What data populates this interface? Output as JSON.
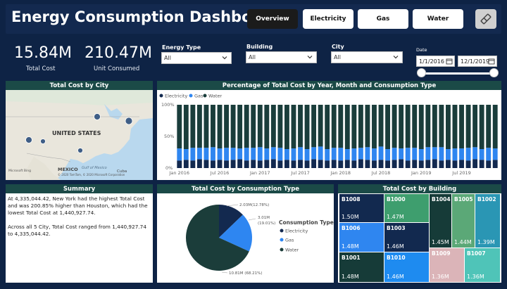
{
  "header": {
    "title": "Energy Consumption Dashboard",
    "tabs": [
      {
        "label": "Overview",
        "active": true
      },
      {
        "label": "Electricity",
        "active": false
      },
      {
        "label": "Gas",
        "active": false
      },
      {
        "label": "Water",
        "active": false
      }
    ],
    "clear_filters_icon": "eraser-icon"
  },
  "kpis": {
    "total_cost": {
      "value": "15.84M",
      "label": "Total Cost"
    },
    "unit_consumed": {
      "value": "210.47M",
      "label": "Unit Consumed"
    }
  },
  "slicers": {
    "energy_type": {
      "label": "Energy Type",
      "value": "All"
    },
    "building": {
      "label": "Building",
      "value": "All"
    },
    "city": {
      "label": "City",
      "value": "All"
    },
    "date": {
      "label": "Date",
      "start": "1/1/2016",
      "end": "12/1/2019"
    }
  },
  "map": {
    "title": "Total Cost by City",
    "labels": {
      "country": "UNITED STATES",
      "mexico": "MEXICO",
      "gulf": "Gulf of Mexico",
      "cuba": "Cuba"
    },
    "attribution": "© 2020 TomTom, © 2020 Microsoft Corporation",
    "brand": "Microsoft Bing"
  },
  "summary": {
    "title": "Summary",
    "paragraph1": "At 4,335,044.42, New York had the highest Total Cost and was 200.85% higher than Houston, which had the lowest Total Cost at 1,440,927.74.",
    "paragraph2": "Across all 5 City, Total Cost ranged from 1,440,927.74 to 4,335,044.42."
  },
  "chart_data": [
    {
      "type": "bar",
      "stacked": "100%",
      "title": "Percentage of Total Cost by Year, Month and Consumption Type",
      "legend_position": "top-left",
      "series_names": [
        "Electricity",
        "Gas",
        "Water"
      ],
      "colors": {
        "Electricity": "#12294f",
        "Gas": "#2f86f0",
        "Water": "#1a3d3b"
      },
      "y_ticks": [
        "100%",
        "50%",
        "0%"
      ],
      "ylim": [
        0,
        100
      ],
      "x_ticks": [
        "Jan 2016",
        "Jul 2016",
        "Jan 2017",
        "Jul 2017",
        "Jan 2018",
        "Jul 2018",
        "Jan 2019",
        "Jul 2019"
      ],
      "start_month": "2016-01",
      "months": 48,
      "electricity_pct": [
        12,
        13,
        12,
        14,
        13,
        12,
        13,
        12,
        13,
        14,
        12,
        13,
        12,
        13,
        14,
        12,
        13,
        12,
        13,
        12,
        14,
        13,
        12,
        13,
        12,
        13,
        12,
        14,
        13,
        12,
        13,
        12,
        13,
        14,
        12,
        13,
        12,
        13,
        14,
        12,
        13,
        12,
        13,
        12,
        14,
        13,
        12,
        13
      ],
      "gas_pct": [
        19,
        17,
        20,
        18,
        19,
        21,
        18,
        20,
        19,
        17,
        20,
        19,
        21,
        18,
        19,
        20,
        17,
        19,
        20,
        18,
        19,
        21,
        18,
        19,
        20,
        17,
        19,
        18,
        20,
        19,
        21,
        18,
        19,
        17,
        20,
        19,
        18,
        20,
        19,
        21,
        17,
        19,
        18,
        20,
        19,
        17,
        20,
        18
      ]
    },
    {
      "type": "pie",
      "title": "Total Cost by Consumption Type",
      "legend_title": "Consumption Type",
      "slices": [
        {
          "name": "Electricity",
          "value": 2.03,
          "pct": 12.78,
          "label": "2.03M",
          "pct_label": "(12.78%)",
          "color": "#13294f"
        },
        {
          "name": "Gas",
          "value": 3.01,
          "pct": 19.01,
          "label": "3.01M",
          "pct_label": "(19.01%)",
          "color": "#2e86f1"
        },
        {
          "name": "Water",
          "value": 10.81,
          "pct": 68.21,
          "label": "10.81M (68.21%)",
          "color": "#1b3d3a"
        }
      ]
    }
  ],
  "treemap": {
    "title": "Total Cost by Building",
    "tiles": [
      {
        "name": "B1008",
        "value": "1.50M",
        "color": "#12294f"
      },
      {
        "name": "B1000",
        "value": "1.47M",
        "color": "#3e9e6e"
      },
      {
        "name": "B1004",
        "value": "1.45M",
        "color": "#163b38"
      },
      {
        "name": "B1005",
        "value": "1.44M",
        "color": "#5ba877"
      },
      {
        "name": "B1002",
        "value": "1.39M",
        "color": "#2a96b4"
      },
      {
        "name": "B1006",
        "value": "1.48M",
        "color": "#2f86f0"
      },
      {
        "name": "B1003",
        "value": "1.46M",
        "color": "#12294f"
      },
      {
        "name": "B1009",
        "value": "1.36M",
        "color": "#dbb4b8"
      },
      {
        "name": "B1007",
        "value": "1.36M",
        "color": "#4fc4b8"
      },
      {
        "name": "B1001",
        "value": "1.48M",
        "color": "#163b38"
      },
      {
        "name": "B1010",
        "value": "1.46M",
        "color": "#1e8bf0"
      }
    ]
  }
}
